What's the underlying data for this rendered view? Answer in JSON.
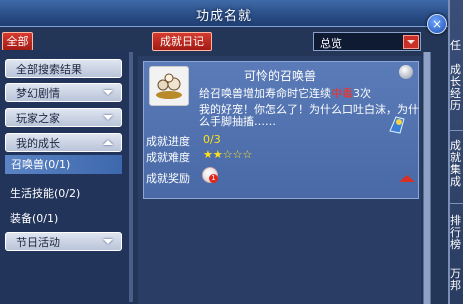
{
  "window": {
    "title": "功成名就",
    "close_label": "×"
  },
  "toolbar": {
    "all_button": "全部",
    "diary_button": "成就日记",
    "filter_value": "总览"
  },
  "sidebar": {
    "items": [
      {
        "label": "全部搜索结果",
        "state": "collapsed"
      },
      {
        "label": "梦幻剧情",
        "state": "collapsed"
      },
      {
        "label": "玩家之家",
        "state": "collapsed"
      },
      {
        "label": "我的成长",
        "state": "expanded"
      }
    ],
    "subitems": [
      {
        "label": "召唤兽(0/1)",
        "selected": true
      },
      {
        "label": "生活技能(0/2)",
        "selected": false
      },
      {
        "label": "装备(0/1)",
        "selected": false
      }
    ],
    "last_item": {
      "label": "节日活动",
      "state": "collapsed"
    }
  },
  "achievement": {
    "title": "可怜的召唤兽",
    "desc_prefix": "给召唤兽增加寿命时它连续",
    "desc_highlight": "中毒",
    "desc_suffix": "3次",
    "flavor_line1": "我的好宠！你怎么了！为什么口吐白沫，为什",
    "flavor_line2": "么手脚抽搐……",
    "progress_label": "成就进度",
    "progress_value": "0/3",
    "difficulty_label": "成就难度",
    "difficulty_stars": "★★☆☆☆",
    "reward_label": "成就奖励",
    "reward_badge": "1"
  },
  "right_strip": {
    "items": [
      "任",
      "成长经历",
      "成就集成",
      "排行榜",
      "万邦"
    ]
  },
  "colors": {
    "accent_red": "#d63b2f",
    "highlight_red": "#ff2b1f",
    "progress_yellow": "#ffe11a",
    "card_blue": "#5a7bb8"
  }
}
